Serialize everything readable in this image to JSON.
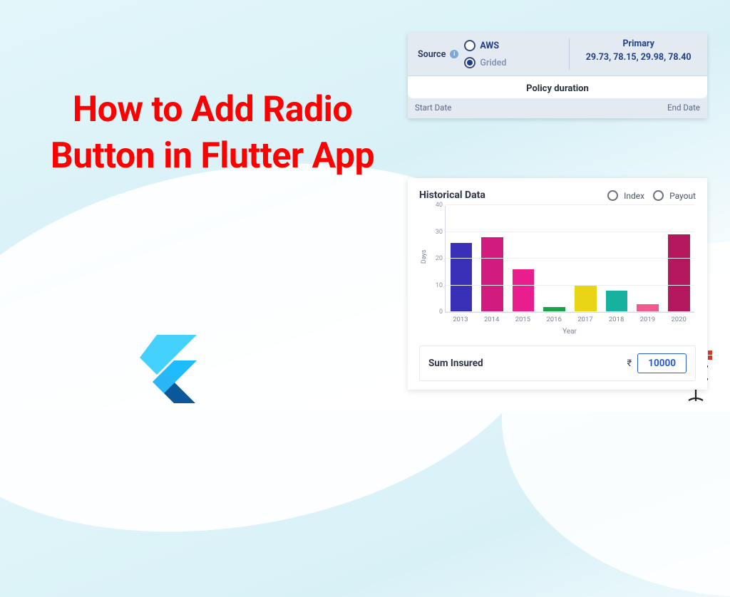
{
  "headline": "How to Add Radio Button in Flutter App",
  "card1": {
    "source_label": "Source",
    "options": {
      "aws": "AWS",
      "grided": "Grided"
    },
    "selected": "grided",
    "primary_title": "Primary",
    "primary_coords": "29.73, 78.15, 29.98, 78.40",
    "policy_title": "Policy duration",
    "start_label": "Start Date",
    "end_label": "End Date"
  },
  "card2": {
    "title": "Historical Data",
    "radio_index": "Index",
    "radio_payout": "Payout",
    "sum_label": "Sum Insured",
    "currency": "₹",
    "sum_value": "10000"
  },
  "chart_data": {
    "type": "bar",
    "title": "Historical Data",
    "xlabel": "Year",
    "ylabel": "Days",
    "ylim": [
      0,
      40
    ],
    "yticks": [
      0,
      10,
      20,
      30,
      40
    ],
    "categories": [
      "2013",
      "2014",
      "2015",
      "2016",
      "2017",
      "2018",
      "2019",
      "2020"
    ],
    "values": [
      26,
      28,
      16,
      2,
      10,
      8,
      3,
      29
    ],
    "colors": [
      "#3a2fb7",
      "#d11b7e",
      "#e91e8c",
      "#1aa24a",
      "#e9d516",
      "#17b1a0",
      "#f05a8c",
      "#b5175e"
    ]
  }
}
